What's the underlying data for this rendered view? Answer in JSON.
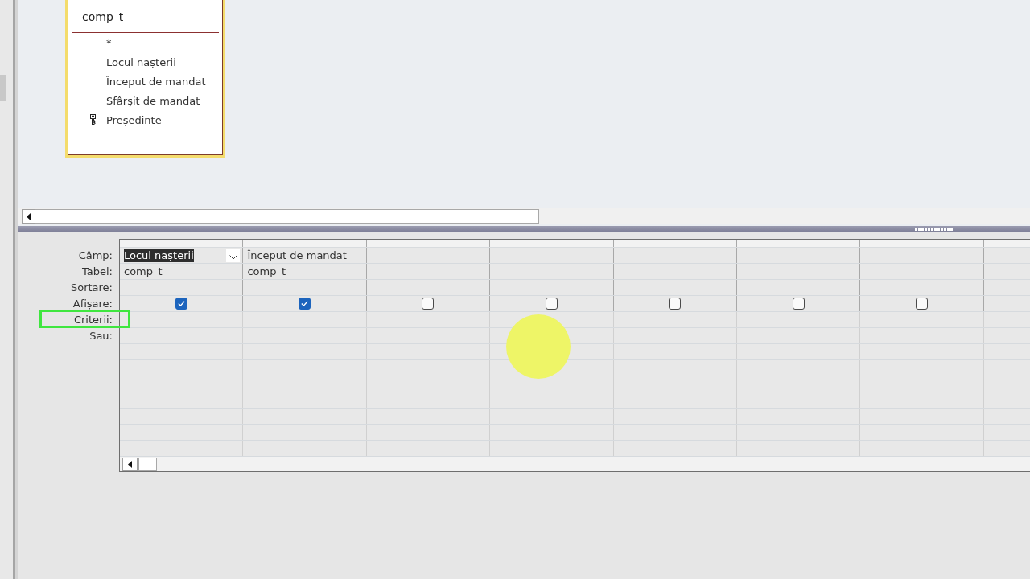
{
  "field_list": {
    "title": "comp_t",
    "selected": true,
    "fields": [
      {
        "name": "*",
        "key": false
      },
      {
        "name": "Locul nașterii",
        "key": false
      },
      {
        "name": "Început de mandat",
        "key": false
      },
      {
        "name": "Sfârșit de mandat",
        "key": false
      },
      {
        "name": "Președinte",
        "key": true
      }
    ]
  },
  "design_grid": {
    "row_labels": [
      "Câmp:",
      "Tabel:",
      "Sortare:",
      "Afișare:",
      "Criterii:",
      "Sau:"
    ],
    "columns": [
      {
        "field": "Locul nașterii",
        "selected": true,
        "table": "comp_t",
        "show": true
      },
      {
        "field": "Început de mandat",
        "selected": false,
        "table": "comp_t",
        "show": true
      },
      {
        "show": false
      },
      {
        "show": false
      },
      {
        "show": false
      },
      {
        "show": false
      },
      {
        "show": false
      }
    ]
  }
}
